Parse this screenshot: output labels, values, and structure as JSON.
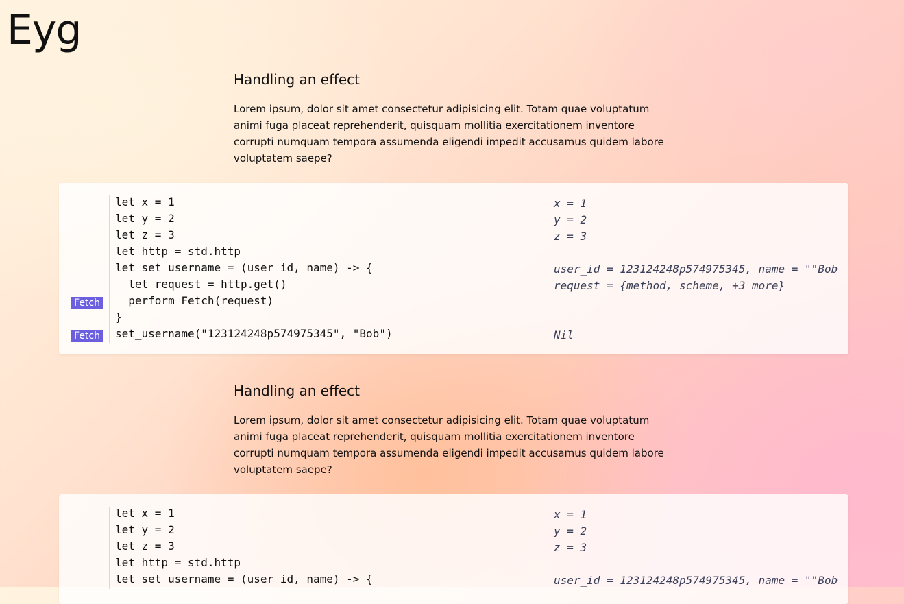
{
  "app": {
    "title": "Eyg"
  },
  "sections": [
    {
      "heading": "Handling an effect",
      "body": "Lorem ipsum, dolor sit amet consectetur adipisicing elit. Totam quae voluptatum animi fuga placeat reprehenderit, quisquam mollitia exercitationem inventore corrupti numquam tempora assumenda eligendi impedit accusamus quidem labore voluptatem saepe?",
      "effects": [
        "",
        "",
        "",
        "",
        "",
        "",
        "Fetch",
        "",
        "Fetch"
      ],
      "code": [
        "let x = 1",
        "let y = 2",
        "let z = 3",
        "let http = std.http",
        "let set_username = (user_id, name) -> {",
        "  let request = http.get()",
        "  perform Fetch(request)",
        "}",
        "set_username(\"123124248p574975345\", \"Bob\")"
      ],
      "results": [
        "x = 1",
        "y = 2",
        "z = 3",
        "",
        "user_id = 123124248p574975345, name = \"\"Bob",
        "request = {method, scheme, +3 more}",
        "",
        "",
        "Nil"
      ]
    },
    {
      "heading": "Handling an effect",
      "body": "Lorem ipsum, dolor sit amet consectetur adipisicing elit. Totam quae voluptatum animi fuga placeat reprehenderit, quisquam mollitia exercitationem inventore corrupti numquam tempora assumenda eligendi impedit accusamus quidem labore voluptatem saepe?",
      "effects": [
        "",
        "",
        "",
        "",
        ""
      ],
      "code": [
        "let x = 1",
        "let y = 2",
        "let z = 3",
        "let http = std.http",
        "let set_username = (user_id, name) -> {"
      ],
      "results": [
        "x = 1",
        "y = 2",
        "z = 3",
        "",
        "user_id = 123124248p574975345, name = \"\"Bob"
      ]
    }
  ]
}
